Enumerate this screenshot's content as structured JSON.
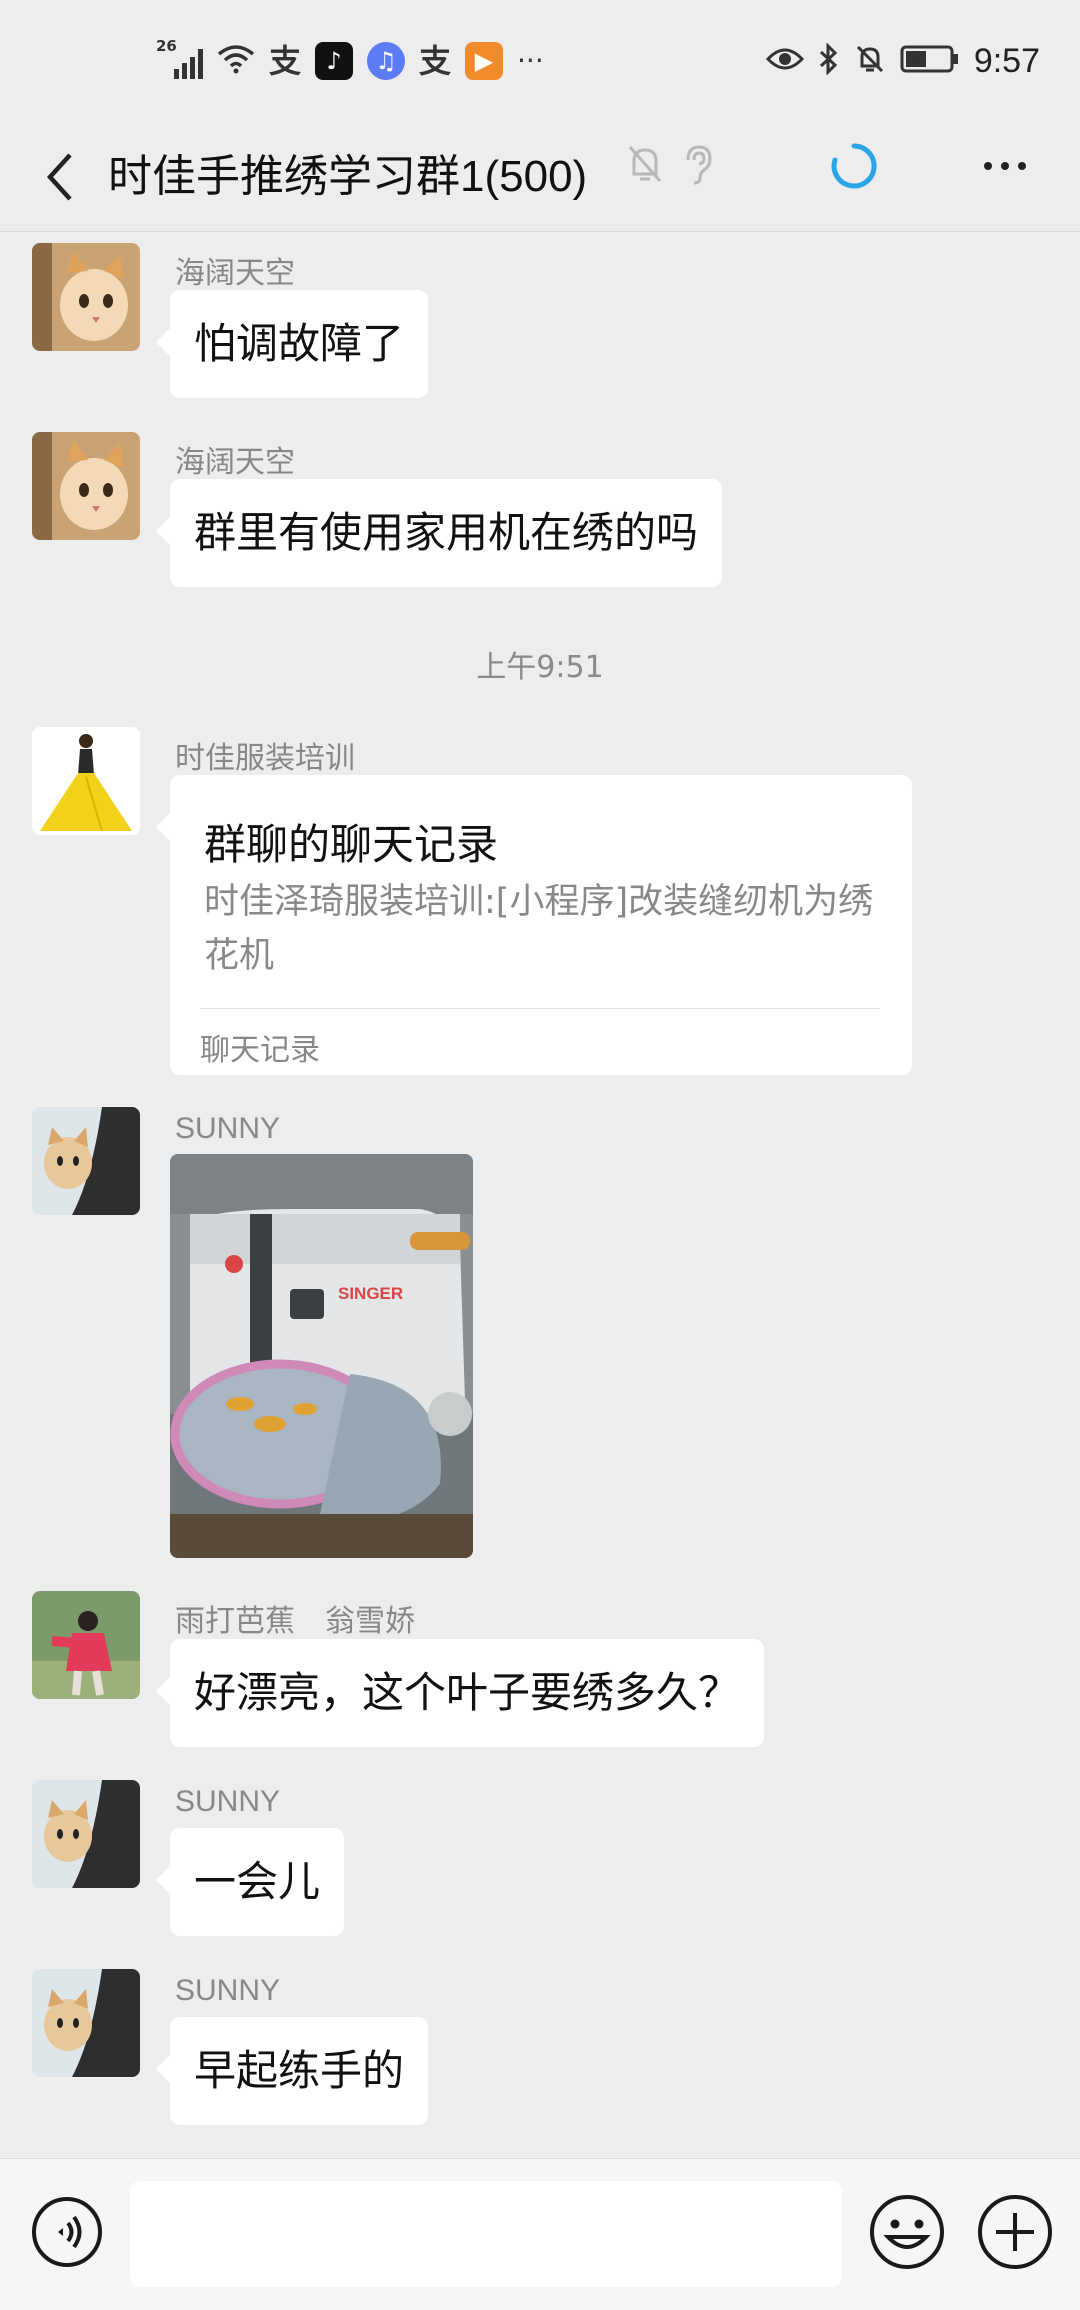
{
  "status_bar": {
    "network": "26",
    "time": "9:57",
    "more": "···"
  },
  "header": {
    "title": "时佳手推绣学习群1(500)"
  },
  "messages": [
    {
      "sender": "海阔天空",
      "text": "怕调故障了"
    },
    {
      "sender": "海阔天空",
      "text": "群里有使用家用机在绣的吗"
    },
    {
      "sender": "时佳服装培训",
      "card_title": "群聊的聊天记录",
      "card_desc": "时佳泽琦服装培训:[小程序]改装缝纫机为绣花机",
      "card_footer": "聊天记录"
    },
    {
      "sender": "SUNNY",
      "image_caption": "SINGER"
    },
    {
      "sender": "雨打芭蕉　翁雪娇",
      "text": "好漂亮，这个叶子要绣多久？"
    },
    {
      "sender": "SUNNY",
      "text": "一会儿"
    },
    {
      "sender": "SUNNY",
      "text": "早起练手的"
    }
  ],
  "timestamp": "上午9:51",
  "input": {
    "placeholder": ""
  },
  "colors": {
    "background": "#ededed",
    "bubble": "#ffffff",
    "loading_accent": "#2aa5e8"
  }
}
